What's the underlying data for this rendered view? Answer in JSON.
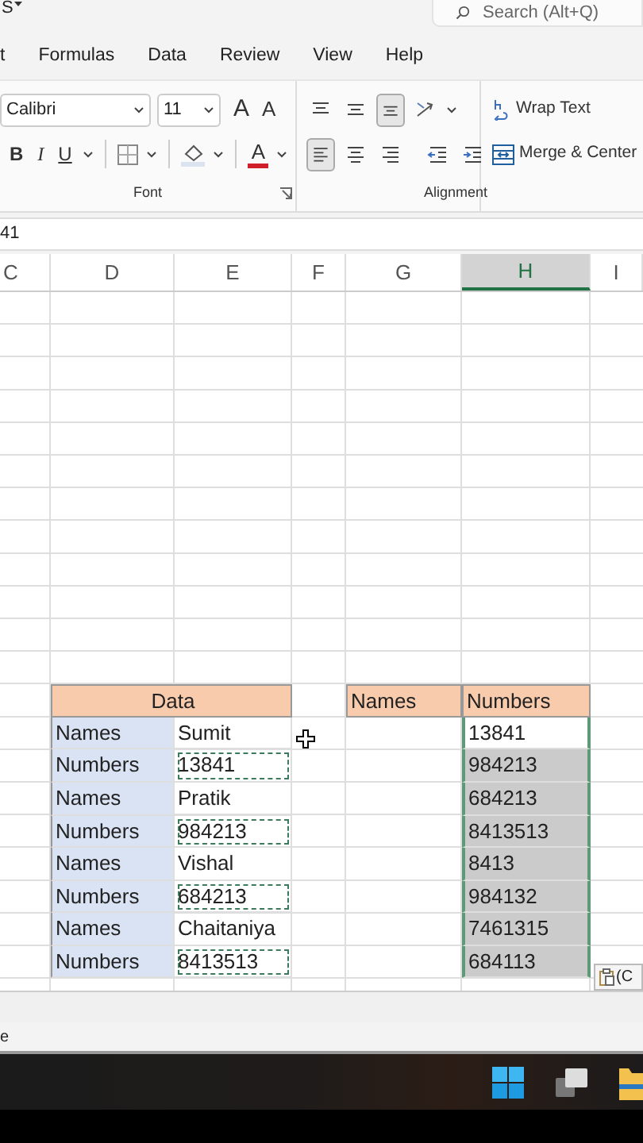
{
  "title_bar": {
    "title": "S",
    "search": {
      "placeholder": "Search (Alt+Q)"
    }
  },
  "menu_tabs": [
    {
      "label": "t"
    },
    {
      "label": "Formulas"
    },
    {
      "label": "Data"
    },
    {
      "label": "Review"
    },
    {
      "label": "View"
    },
    {
      "label": "Help"
    }
  ],
  "font_group": {
    "label": "Font",
    "font_name": "Calibri",
    "font_size": "11",
    "grow_label": "A",
    "shrink_label": "A",
    "format_buttons": [
      {
        "kind": "bold",
        "label": "B"
      },
      {
        "kind": "italic",
        "label": "I"
      },
      {
        "kind": "underline",
        "label": "U"
      }
    ],
    "font_color_label": "A"
  },
  "alignment_group": {
    "label": "Alignment",
    "row_1": [
      {
        "kind": "top",
        "on": false
      },
      {
        "kind": "middle",
        "on": false
      },
      {
        "kind": "bottom",
        "on": true
      },
      {
        "kind": "orientation",
        "on": false
      }
    ],
    "row_2": [
      {
        "kind": "left",
        "on": true
      },
      {
        "kind": "center",
        "on": false
      },
      {
        "kind": "right",
        "on": false
      },
      {
        "kind": "decrease-indent",
        "on": false
      },
      {
        "kind": "increase-indent",
        "on": false
      }
    ],
    "wrap_text": "Wrap Text",
    "merge_center": "Merge & Center"
  },
  "formula_bar": {
    "value": "41"
  },
  "columns": [
    {
      "label": "C",
      "selected": false
    },
    {
      "label": "D",
      "selected": false
    },
    {
      "label": "E",
      "selected": false
    },
    {
      "label": "F",
      "selected": false
    },
    {
      "label": "G",
      "selected": false
    },
    {
      "label": "H",
      "selected": true
    },
    {
      "label": "I",
      "selected": false
    }
  ],
  "data_table": {
    "header": "Data",
    "rows": [
      {
        "label": "Names",
        "value": "Sumit",
        "copied": false
      },
      {
        "label": "Numbers",
        "value": "13841",
        "copied": true
      },
      {
        "label": "Names",
        "value": "Pratik",
        "copied": false
      },
      {
        "label": "Numbers",
        "value": "984213",
        "copied": true
      },
      {
        "label": "Names",
        "value": "Vishal",
        "copied": false
      },
      {
        "label": "Numbers",
        "value": "684213",
        "copied": true
      },
      {
        "label": "Names",
        "value": "Chaitaniya",
        "copied": false
      },
      {
        "label": "Numbers",
        "value": "8413513",
        "copied": true
      }
    ]
  },
  "result_table": {
    "columns": [
      "Names",
      "Numbers"
    ],
    "rows": [
      {
        "number": "13841",
        "selected": false
      },
      {
        "number": "984213",
        "selected": true
      },
      {
        "number": "684213",
        "selected": true
      },
      {
        "number": "8413513",
        "selected": true
      },
      {
        "number": "8413",
        "selected": true
      },
      {
        "number": "984132",
        "selected": true
      },
      {
        "number": "7461315",
        "selected": true
      },
      {
        "number": "684113",
        "selected": true
      }
    ]
  },
  "paste_options": {
    "label": "(C"
  },
  "status_bar": {
    "text": "e"
  }
}
